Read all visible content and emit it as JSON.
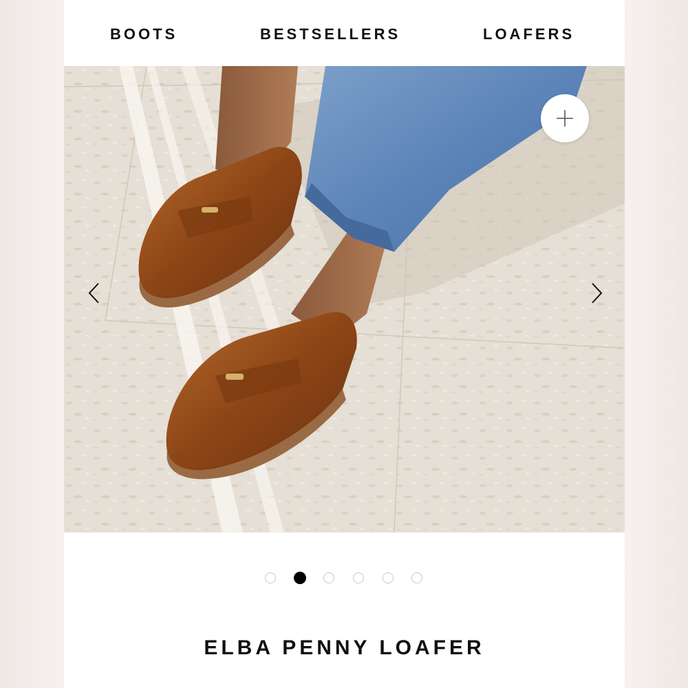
{
  "nav": {
    "items": [
      {
        "label": "BOOTS"
      },
      {
        "label": "BESTSELLERS"
      },
      {
        "label": "LOAFERS"
      }
    ]
  },
  "hero": {
    "image_description_icon": "product-photo",
    "zoom_icon": "plus-icon",
    "prev_icon": "chevron-left-icon",
    "next_icon": "chevron-right-icon"
  },
  "carousel": {
    "total_slides": 6,
    "active_slide": 2
  },
  "product": {
    "title": "ELBA PENNY LOAFER"
  },
  "colors": {
    "text": "#111111",
    "dot_inactive": "#c9c9c9",
    "dot_active": "#000000",
    "background": "#ffffff"
  }
}
